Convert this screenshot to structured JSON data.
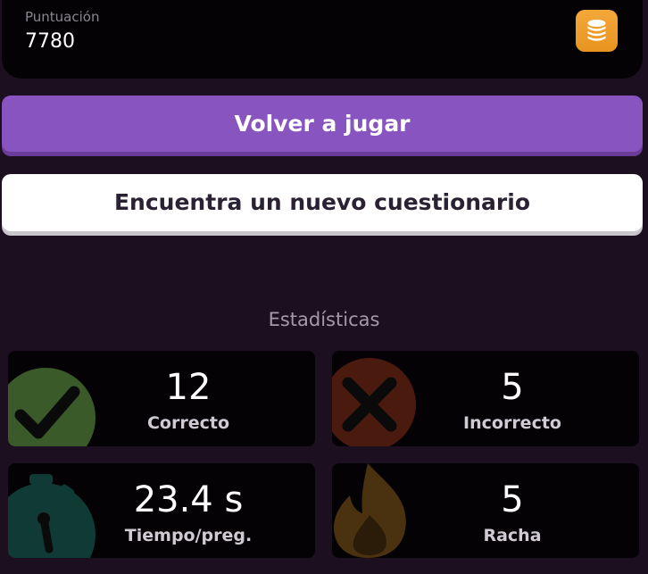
{
  "score": {
    "label": "Puntuación",
    "value": "7780",
    "icon": "coins-icon",
    "badge_color": "#f0a030"
  },
  "buttons": {
    "play_again": "Volver a jugar",
    "find_quiz": "Encuentra un nuevo cuestionario"
  },
  "stats": {
    "title": "Estadísticas",
    "items": [
      {
        "value": "12",
        "label": "Correcto",
        "icon": "check-icon",
        "color": "#3a5a2a"
      },
      {
        "value": "5",
        "label": "Incorrecto",
        "icon": "cross-icon",
        "color": "#4a1a0e"
      },
      {
        "value": "23.4 s",
        "label": "Tiempo/preg.",
        "icon": "stopwatch-icon",
        "color": "#0f3a35"
      },
      {
        "value": "5",
        "label": "Racha",
        "icon": "flame-icon",
        "color": "#4a3210"
      }
    ]
  },
  "colors": {
    "background": "#1c0f1f",
    "primary_button": "#8854c0",
    "secondary_button": "#ffffff"
  }
}
